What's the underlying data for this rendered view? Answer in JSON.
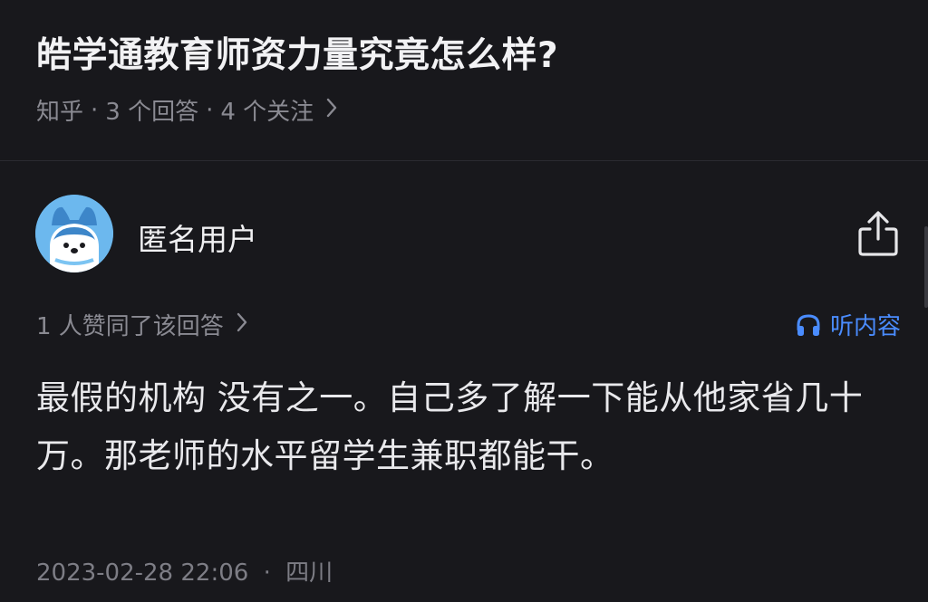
{
  "question": {
    "title": "皓学通教育师资力量究竟怎么样?",
    "source": "知乎",
    "answers_count": "3 个回答",
    "followers": "4 个关注",
    "separator": "·"
  },
  "author": {
    "name": "匿名用户",
    "avatar_icon": "anonymous-user-avatar"
  },
  "votes": {
    "text": "1 人赞同了该回答"
  },
  "listen": {
    "label": "听内容",
    "icon": "headphones-icon"
  },
  "answer": {
    "content": "最假的机构 没有之一。自己多了解一下能从他家省几十万。那老师的水平留学生兼职都能干。"
  },
  "footer": {
    "timestamp": "2023-02-28 22:06",
    "location": "四川"
  },
  "colors": {
    "background": "#18181c",
    "accent": "#4a8cff",
    "muted": "#8a8a92"
  }
}
